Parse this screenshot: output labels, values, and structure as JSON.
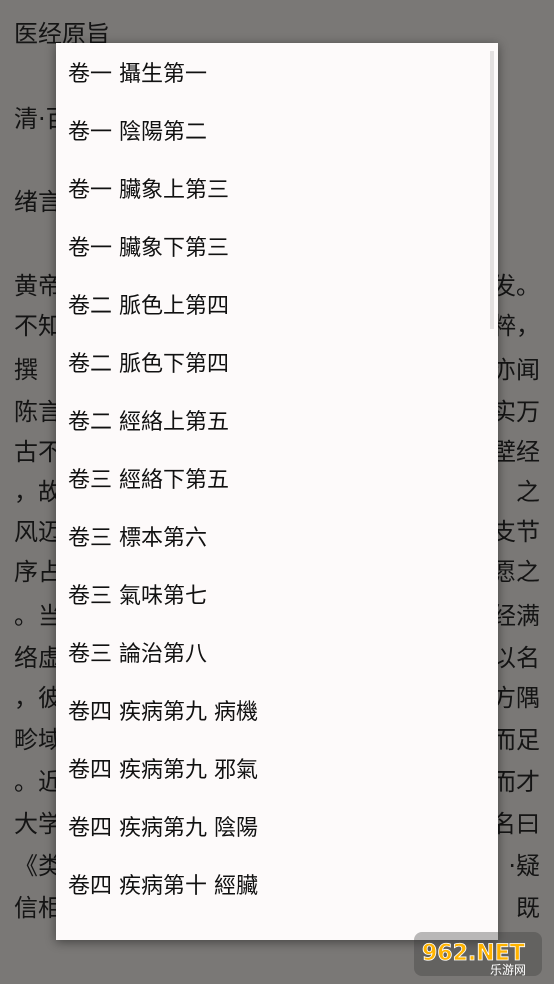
{
  "background": {
    "title": "医经原旨",
    "left_lines": [
      "清·百",
      "绪言",
      "黄帝",
      "不知",
      "撰",
      "陈言",
      "古不",
      "，故",
      "风迈",
      "序占",
      "。当",
      "络虚",
      "，彼",
      "畛域",
      "。近",
      "大学",
      "《类",
      "信相"
    ],
    "right_lines": [
      "发。",
      "粹，",
      "亦闻",
      "实万",
      "壁经",
      "之",
      "支节",
      "愿之",
      "经满",
      "以名",
      "方隅",
      "而足",
      "而才",
      "名曰",
      "·疑",
      "既"
    ]
  },
  "menu": {
    "items": [
      "卷一 攝生第一",
      "卷一 陰陽第二",
      "卷一 臟象上第三",
      "卷一 臟象下第三",
      "卷二 脈色上第四",
      "卷二 脈色下第四",
      "卷二 經絡上第五",
      "卷三 經絡下第五",
      "卷三 標本第六",
      "卷三 氣味第七",
      "卷三 論治第八",
      "卷四 疾病第九 病機",
      "卷四 疾病第九 邪氣",
      "卷四 疾病第九 陰陽",
      "卷四 疾病第十 經臟"
    ]
  },
  "watermark": {
    "text": "962.NET",
    "sub": "乐游网"
  }
}
